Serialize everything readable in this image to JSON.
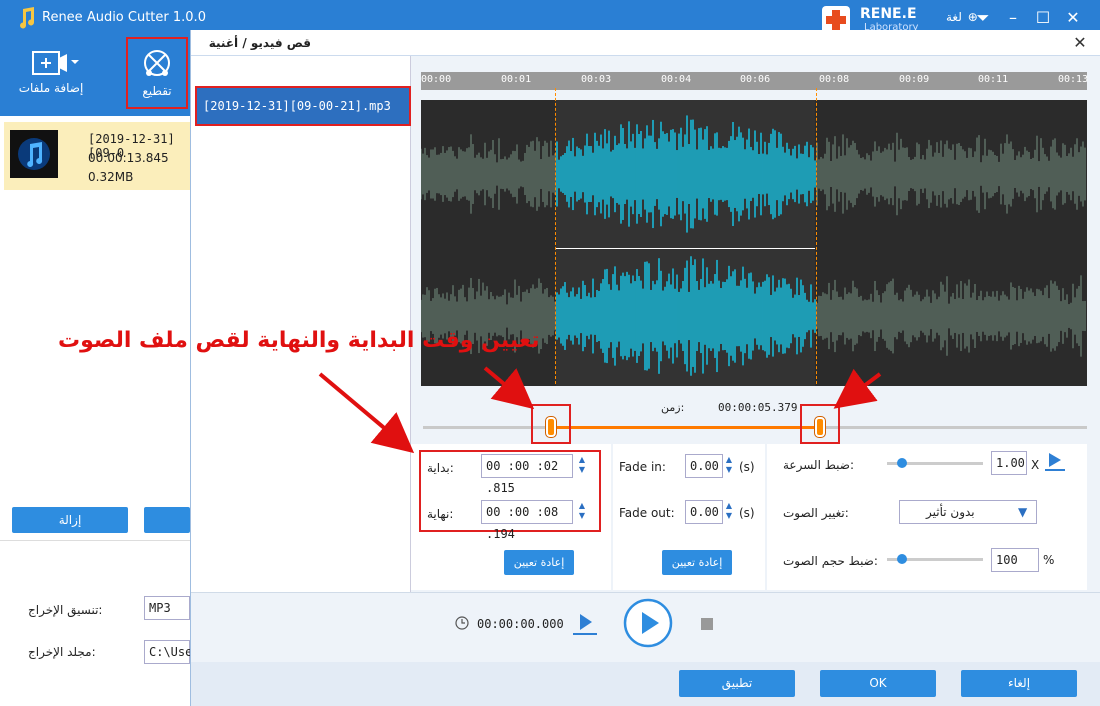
{
  "app": {
    "title": "Renee Audio Cutter 1.0.0",
    "language_label": "لغة",
    "logo_top": "RENE.E",
    "logo_bottom": "Laboratory"
  },
  "toolbar": {
    "add_files_label": "إضافة ملفات",
    "cut_label": "تقطيع"
  },
  "file": {
    "name": "[2019-12-31][09-0",
    "duration": "00:00:13.845",
    "size": "0.32MB"
  },
  "left": {
    "remove_label": "إزالة",
    "format_label": "تنسيق الإخراج:",
    "format_value": "MP3",
    "folder_label": "مجلد الإخراج:",
    "folder_value": "C:\\Use"
  },
  "dialog": {
    "title": "قص فيديو / أغنية",
    "file_item": "[2019-12-31][09-00-21].mp3",
    "ticks": [
      "00:00",
      "00:01",
      "00:03",
      "00:04",
      "00:06",
      "00:08",
      "00:09",
      "00:11",
      "00:13"
    ],
    "time_label": "زمن:",
    "current_time": "00:00:05.379",
    "start_label": "بداية:",
    "start_value": "00 :00 :02 .815",
    "end_label": "نهاية:",
    "end_value": "00 :00 :08 .194",
    "reset_label": "إعادة تعيين",
    "fade_in_label": "Fade in:",
    "fade_in_value": "0.00",
    "fade_out_label": "Fade out:",
    "fade_out_value": "0.00",
    "sec_unit": "(s)",
    "reset2_label": "إعادة تعيين",
    "speed_label": "ضبط السرعة:",
    "speed_value": "1.00",
    "speed_unit": "X",
    "voice_change_label": "تغيير الصوت:",
    "voice_change_value": "بدون تأثير",
    "volume_label": "ضبط حجم الصوت:",
    "volume_value": "100",
    "volume_unit": "%",
    "play_time": "00:00:00.000",
    "apply_label": "تطبيق",
    "ok_label": "OK",
    "cancel_label": "إلغاء"
  },
  "annotation": "تعيين وقت البداية والنهاية لقص ملف الصوت",
  "colors": {
    "accent": "#2a7fd4",
    "wave_selected": "#1ab7d6",
    "wave_unselected": "#5a6b62",
    "marker": "#ff8c00",
    "highlight": "#e02020"
  }
}
